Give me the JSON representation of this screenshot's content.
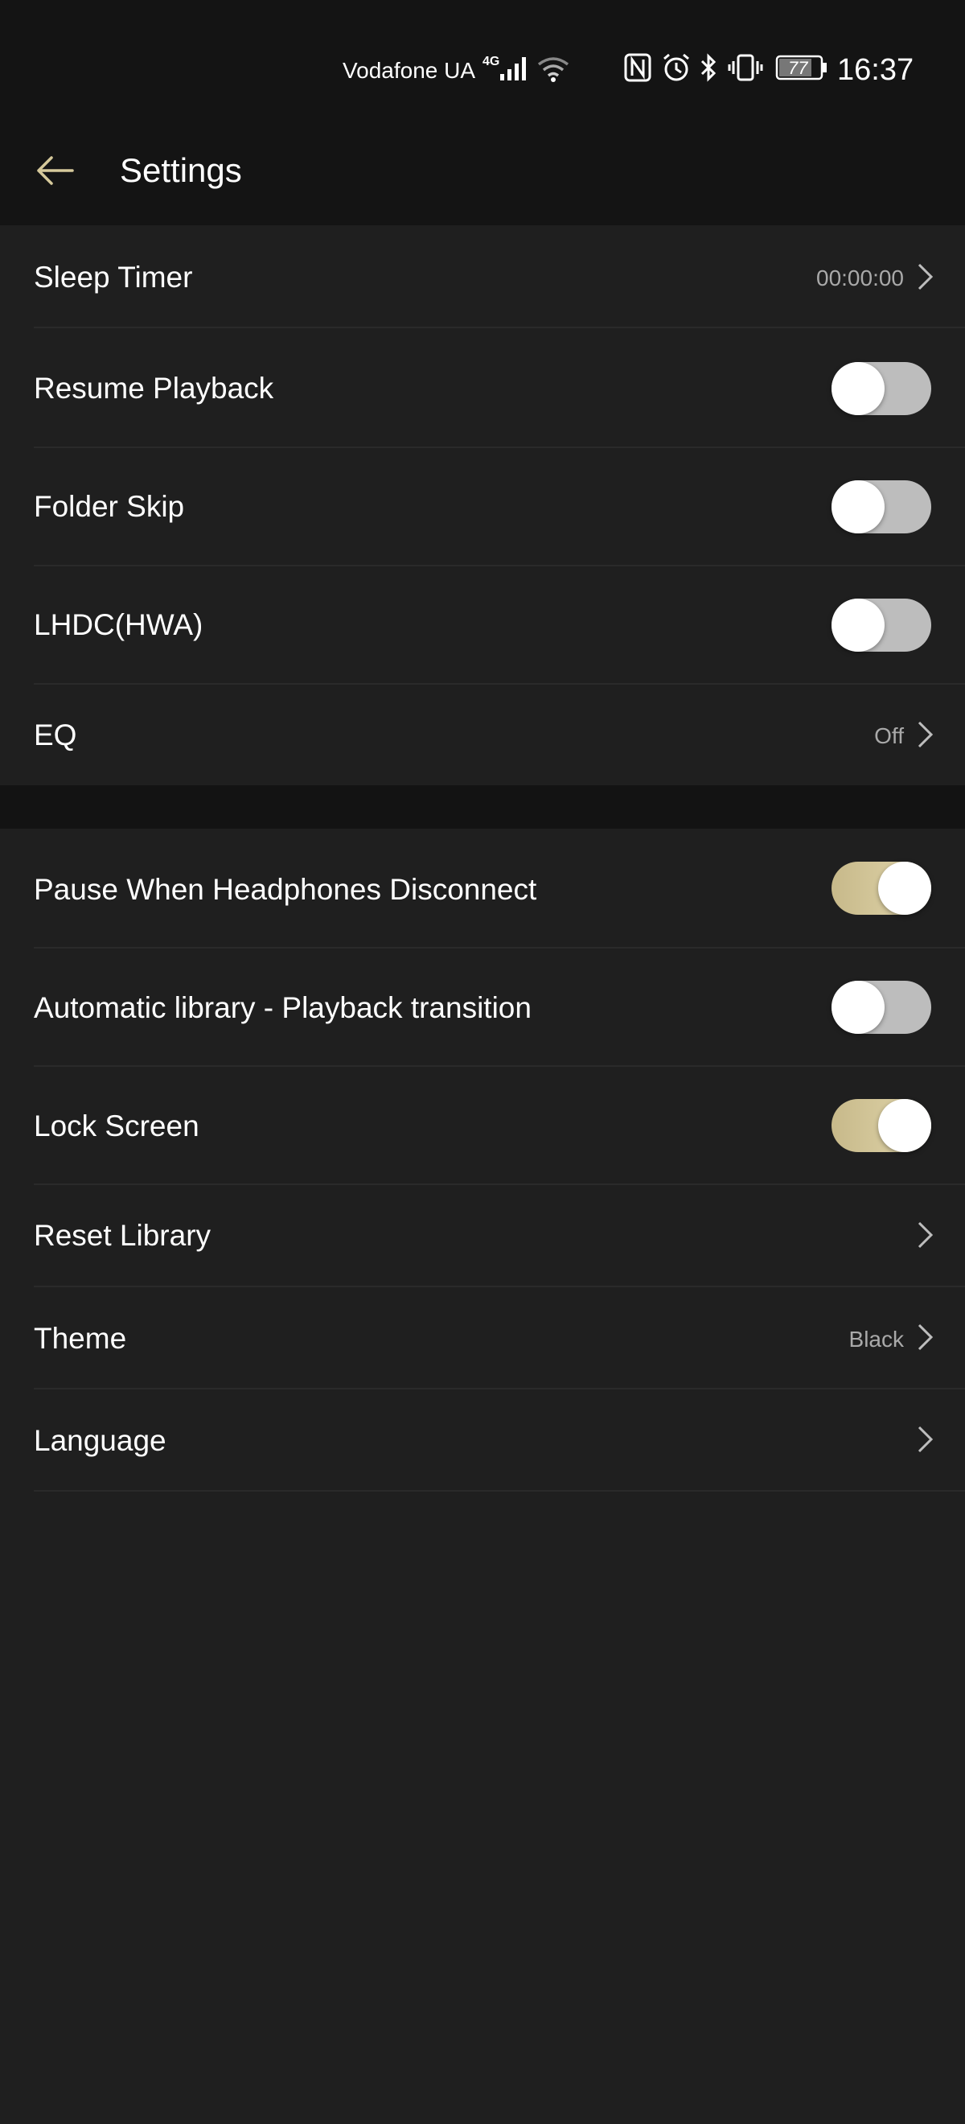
{
  "status_bar": {
    "carrier": "Vodafone UA",
    "network": "4G",
    "battery": "77",
    "time": "16:37"
  },
  "app_bar": {
    "title": "Settings"
  },
  "settings": {
    "sleep_timer": {
      "label": "Sleep Timer",
      "value": "00:00:00"
    },
    "resume_playback": {
      "label": "Resume Playback",
      "enabled": false
    },
    "folder_skip": {
      "label": "Folder Skip",
      "enabled": false
    },
    "lhdc": {
      "label": "LHDC(HWA)",
      "enabled": false
    },
    "eq": {
      "label": "EQ",
      "value": "Off"
    },
    "pause_headphones": {
      "label": "Pause When Headphones Disconnect",
      "enabled": true
    },
    "auto_library": {
      "label": "Automatic library - Playback transition",
      "enabled": false
    },
    "lock_screen": {
      "label": "Lock Screen",
      "enabled": true
    },
    "reset_library": {
      "label": "Reset Library"
    },
    "theme": {
      "label": "Theme",
      "value": "Black"
    },
    "language": {
      "label": "Language"
    }
  },
  "colors": {
    "accent": "#d6c99b",
    "background": "#1f1f1f",
    "header": "#141414"
  }
}
